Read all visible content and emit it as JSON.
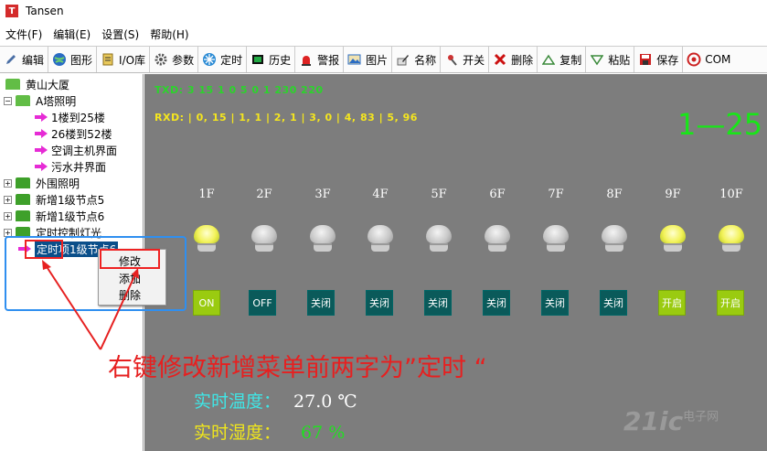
{
  "window": {
    "title": "Tansen",
    "icon_letter": "T"
  },
  "menu": [
    "文件(F)",
    "编辑(E)",
    "设置(S)",
    "帮助(H)"
  ],
  "toolbar": [
    {
      "label": "编辑",
      "icon": "pencil-icon"
    },
    {
      "label": "图形",
      "icon": "globe-icon"
    },
    {
      "label": "I/O库",
      "icon": "database-icon"
    },
    {
      "label": "参数",
      "icon": "gear-icon"
    },
    {
      "label": "定时",
      "icon": "snowflake-icon"
    },
    {
      "label": "历史",
      "icon": "monitor-icon"
    },
    {
      "label": "警报",
      "icon": "alarm-icon"
    },
    {
      "label": "图片",
      "icon": "picture-icon"
    },
    {
      "label": "名称",
      "icon": "edit-icon"
    },
    {
      "label": "开关",
      "icon": "pin-icon"
    },
    {
      "label": "删除",
      "icon": "delete-icon"
    },
    {
      "label": "复制",
      "icon": "triangle-up-icon"
    },
    {
      "label": "粘贴",
      "icon": "triangle-down-icon"
    },
    {
      "label": "保存",
      "icon": "save-icon"
    },
    {
      "label": "COM",
      "icon": "com-icon"
    }
  ],
  "tree": {
    "root": "黄山大厦",
    "a_tower": "A塔照明",
    "a_children": [
      "1楼到25楼",
      "26楼到52楼",
      "空调主机界面",
      "污水井界面"
    ],
    "nodes": [
      "外围照明",
      "新增1级节点5",
      "新增1级节点6",
      "定时控制灯光"
    ],
    "selected": "定时项1级节点6"
  },
  "context_menu": [
    "修改",
    "添加",
    "删除"
  ],
  "panel": {
    "txd": "TXD: 3 15 1 0 5 0 1 230 220",
    "rxd": "RXD:  | 0, 15 | 1, 1 | 2, 1 | 3, 0 | 4, 83 | 5, 96",
    "range": "1—25",
    "floors": [
      "1F",
      "2F",
      "3F",
      "4F",
      "5F",
      "6F",
      "7F",
      "8F",
      "9F",
      "10F"
    ],
    "bulb_states": [
      "on",
      "off",
      "off",
      "off",
      "off",
      "off",
      "off",
      "off",
      "on",
      "on"
    ],
    "buttons": [
      {
        "label": "ON",
        "style": "lime"
      },
      {
        "label": "OFF",
        "style": "teal"
      },
      {
        "label": "关闭",
        "style": "teal"
      },
      {
        "label": "关闭",
        "style": "teal"
      },
      {
        "label": "关闭",
        "style": "teal"
      },
      {
        "label": "关闭",
        "style": "teal"
      },
      {
        "label": "关闭",
        "style": "teal"
      },
      {
        "label": "关闭",
        "style": "teal"
      },
      {
        "label": "开启",
        "style": "lime"
      },
      {
        "label": "开启",
        "style": "lime"
      }
    ],
    "temperature_label": "实时温度：",
    "temperature_value": "27.0 ℃",
    "humidity_label": "实时湿度：",
    "humidity_value": "67 %"
  },
  "annotation": "右键修改新增菜单前两字为”定时 “",
  "watermark": {
    "main": "21ic",
    "sub": "电子网"
  },
  "colors": {
    "txd": "#2bd42b",
    "rxd": "#f5e61e",
    "range": "#18e618",
    "canvas": "#7d7d7d",
    "annotation": "#e62020",
    "blue_frame": "#2f8ff0"
  }
}
